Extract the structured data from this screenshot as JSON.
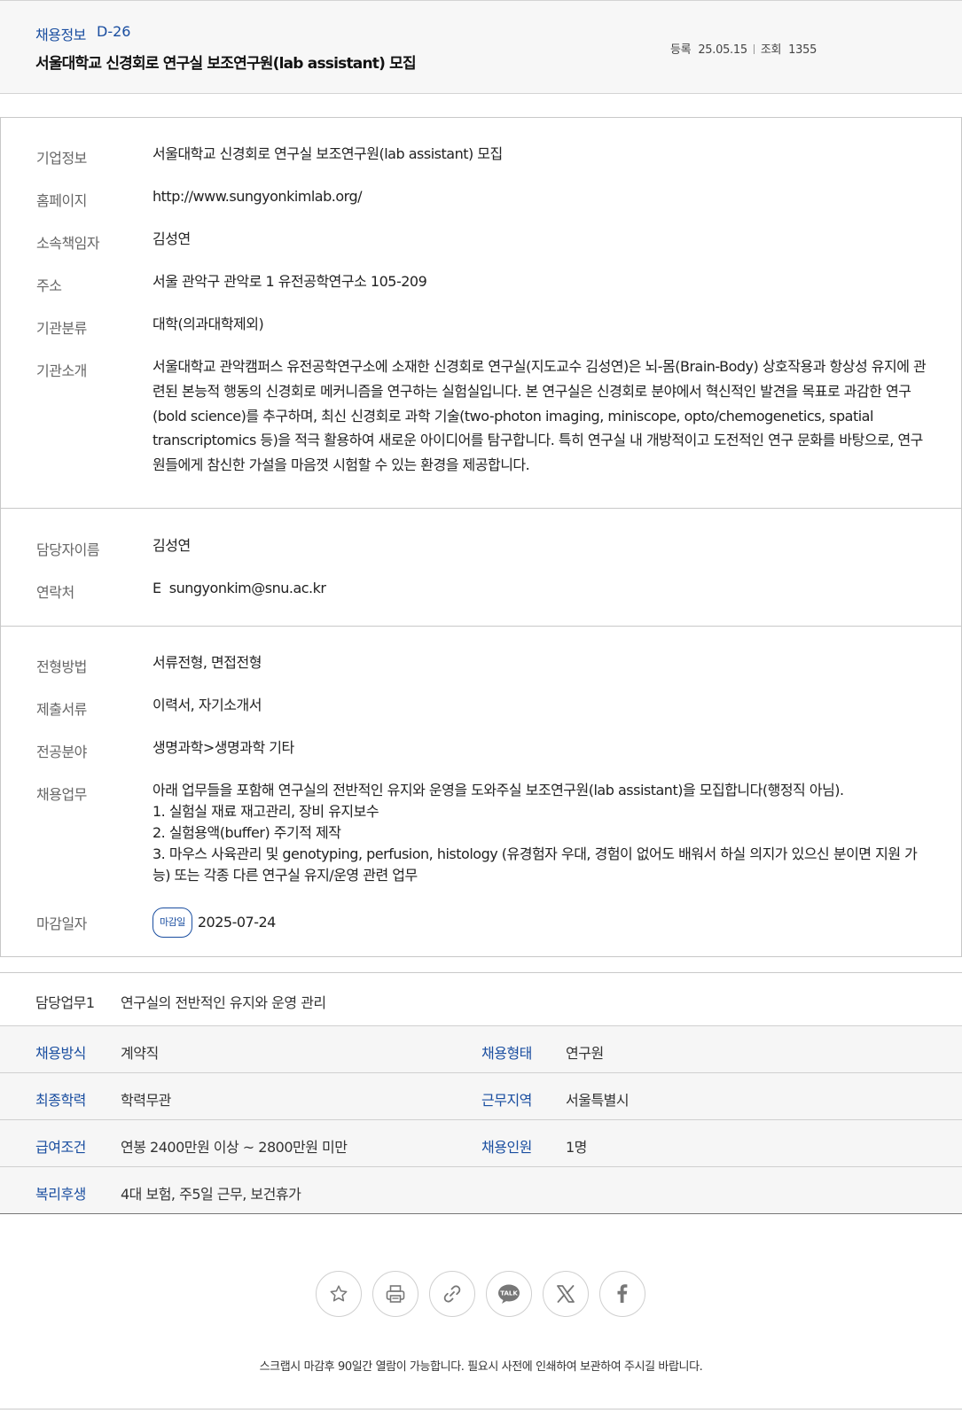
{
  "header": {
    "category": "채용정보",
    "dday": "D-26",
    "title": "서울대학교 신경회로 연구실 보조연구원(lab assistant) 모집",
    "reg_label": "등록",
    "reg_date": "25.05.15",
    "views_label": "조회",
    "views": "1355"
  },
  "company": {
    "rows": [
      {
        "label": "기업정보",
        "value": "서울대학교 신경회로 연구실 보조연구원(lab assistant) 모집"
      },
      {
        "label": "홈페이지",
        "value": "http://www.sungyonkimlab.org/"
      },
      {
        "label": "소속책임자",
        "value": "김성연"
      },
      {
        "label": "주소",
        "value": "서울 관악구 관악로 1 유전공학연구소 105-209"
      },
      {
        "label": "기관분류",
        "value": "대학(의과대학제외)"
      },
      {
        "label": "기관소개",
        "value": "서울대학교 관악캠퍼스 유전공학연구소에 소재한 신경회로 연구실(지도교수 김성연)은 뇌-몸(Brain-Body) 상호작용과 항상성 유지에 관련된 본능적 행동의 신경회로 메커니즘을 연구하는 실험실입니다. 본 연구실은 신경회로 분야에서 혁신적인 발견을 목표로 과감한 연구(bold science)를 추구하며, 최신 신경회로 과학 기술(two-photon imaging, miniscope, opto/chemogenetics, spatial transcriptomics 등)을 적극 활용하여 새로운 아이디어를 탐구합니다. 특히 연구실 내 개방적이고 도전적인 연구 문화를 바탕으로, 연구원들에게 참신한 가설을 마음껏 시험할 수 있는 환경을 제공합니다."
      }
    ]
  },
  "contact": {
    "name_label": "담당자이름",
    "name": "김성연",
    "contact_label": "연락처",
    "email_prefix": "E",
    "email": "sungyonkim@snu.ac.kr"
  },
  "recruit": {
    "method_label": "전형방법",
    "method": "서류전형, 면접전형",
    "docs_label": "제출서류",
    "docs": "이력서, 자기소개서",
    "field_label": "전공분야",
    "field": "생명과학>생명과학 기타",
    "duty_label": "채용업무",
    "duty_lines": [
      "아래 업무들을 포함해 연구실의 전반적인 유지와 운영을 도와주실 보조연구원(lab assistant)을 모집합니다(행정직 아님).",
      "1. 실험실 재료 재고관리, 장비 유지보수",
      "2. 실험용액(buffer) 주기적 제작",
      "3. 마우스 사육관리 및 genotyping, perfusion, histology (유경험자 우대, 경험이 없어도 배워서 하실 의지가 있으신 분이면 지원 가능) 또는 각종 다른 연구실 유지/운영 관련 업무"
    ],
    "deadline_label": "마감일자",
    "deadline_badge": "마감일",
    "deadline": "2025-07-24"
  },
  "duty_summary": {
    "label": "담당업무1",
    "value": "연구실의 전반적인 유지와 운영 관리"
  },
  "conditions": {
    "employ_method_label": "채용방식",
    "employ_method": "계약직",
    "employ_type_label": "채용형태",
    "employ_type": "연구원",
    "education_label": "최종학력",
    "education": "학력무관",
    "location_label": "근무지역",
    "location": "서울특별시",
    "salary_label": "급여조건",
    "salary": "연봉 2400만원 이상 ~ 2800만원 미만",
    "headcount_label": "채용인원",
    "headcount": "1명",
    "welfare_label": "복리후생",
    "welfare": "4대 보험, 주5일 근무, 보건휴가"
  },
  "share_icons": [
    "star-icon",
    "print-icon",
    "link-icon",
    "kakaotalk-icon",
    "x-icon",
    "facebook-icon"
  ],
  "kakao_text": "TALK",
  "notice": "스크랩시 마감후 90일간 열람이 가능합니다. 필요시 사전에 인쇄하여 보관하여 주시길 바랍니다."
}
